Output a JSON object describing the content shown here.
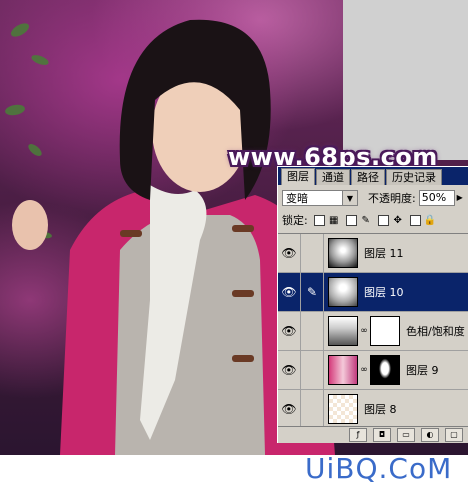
{
  "watermark": "www.68ps.com",
  "site_logo": "UiBQ.CoM",
  "panel": {
    "tabs": [
      "图层",
      "通道",
      "路径",
      "历史记录"
    ],
    "active_tab": "图层",
    "blend_mode": "变暗",
    "opacity_label": "不透明度:",
    "opacity_value": "50%",
    "lock_label": "锁定:",
    "layers": [
      {
        "name": "图层 11",
        "selected": false
      },
      {
        "name": "图层 10",
        "selected": true
      },
      {
        "name": "色相/饱和度",
        "selected": false
      },
      {
        "name": "图层 9",
        "selected": false
      },
      {
        "name": "图层 8",
        "selected": false
      }
    ]
  }
}
